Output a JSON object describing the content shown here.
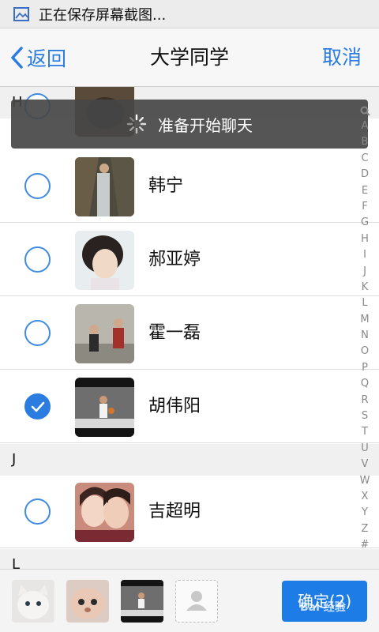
{
  "status_bar": {
    "text": "正在保存屏幕截图..."
  },
  "nav": {
    "back_label": "返回",
    "title": "大学同学",
    "cancel_label": "取消"
  },
  "toast": {
    "text": "准备开始聊天"
  },
  "sections": [
    {
      "letter": "H",
      "contacts": [
        {
          "name": "",
          "checked": false
        },
        {
          "name": "韩宁",
          "checked": false
        },
        {
          "name": "郝亚婷",
          "checked": false
        },
        {
          "name": "霍一磊",
          "checked": false
        },
        {
          "name": "胡伟阳",
          "checked": true
        }
      ]
    },
    {
      "letter": "J",
      "contacts": [
        {
          "name": "吉超明",
          "checked": false
        }
      ]
    },
    {
      "letter": "L",
      "contacts": []
    }
  ],
  "index_letters": [
    "A",
    "B",
    "C",
    "D",
    "E",
    "F",
    "G",
    "H",
    "I",
    "J",
    "K",
    "L",
    "M",
    "N",
    "O",
    "P",
    "Q",
    "R",
    "S",
    "T",
    "U",
    "V",
    "W",
    "X",
    "Y",
    "Z",
    "#"
  ],
  "bottom": {
    "confirm_label": "确定(2)"
  },
  "watermark": "Bai 经验",
  "colors": {
    "accent": "#2a7ce0",
    "toast_bg": "#464646",
    "section_bg": "#f0f0f0"
  }
}
